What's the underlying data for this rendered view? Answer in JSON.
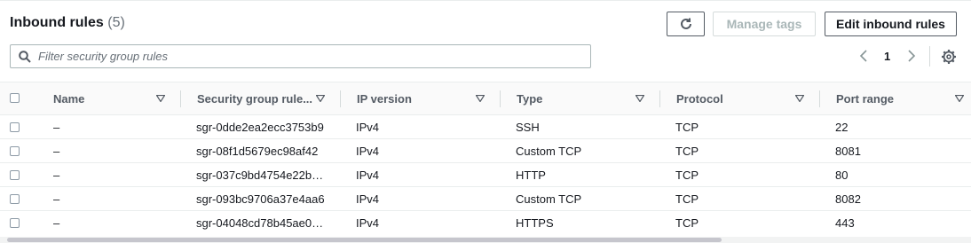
{
  "header": {
    "title": "Inbound rules",
    "count": "(5)"
  },
  "toolbar": {
    "refresh_icon": "refresh-icon",
    "manage_tags_label": "Manage tags",
    "edit_label": "Edit inbound rules"
  },
  "filter": {
    "placeholder": "Filter security group rules",
    "icon": "search-icon"
  },
  "pagination": {
    "current_page": "1"
  },
  "columns": [
    "Name",
    "Security group rule...",
    "IP version",
    "Type",
    "Protocol",
    "Port range"
  ],
  "rows": [
    {
      "name": "–",
      "rule_id": "sgr-0dde2ea2ecc3753b9",
      "ip_version": "IPv4",
      "type": "SSH",
      "protocol": "TCP",
      "port_range": "22"
    },
    {
      "name": "–",
      "rule_id": "sgr-08f1d5679ec98af42",
      "ip_version": "IPv4",
      "type": "Custom TCP",
      "protocol": "TCP",
      "port_range": "8081"
    },
    {
      "name": "–",
      "rule_id": "sgr-037c9bd4754e22b…",
      "ip_version": "IPv4",
      "type": "HTTP",
      "protocol": "TCP",
      "port_range": "80"
    },
    {
      "name": "–",
      "rule_id": "sgr-093bc9706a37e4aa6",
      "ip_version": "IPv4",
      "type": "Custom TCP",
      "protocol": "TCP",
      "port_range": "8082"
    },
    {
      "name": "–",
      "rule_id": "sgr-04048cd78b45ae0…",
      "ip_version": "IPv4",
      "type": "HTTPS",
      "protocol": "TCP",
      "port_range": "443"
    }
  ],
  "colors": {
    "text": "#16191f",
    "muted": "#687078",
    "border": "#aab7b8",
    "disabled": "#aab7b8"
  }
}
